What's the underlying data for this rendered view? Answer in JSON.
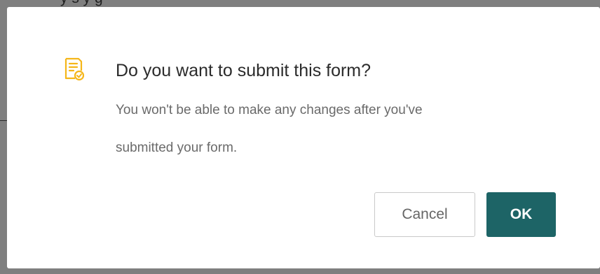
{
  "backdrop": {
    "partial_text": "y  s      y       g"
  },
  "dialog": {
    "icon": "form-check-icon",
    "title": "Do you want to submit this form?",
    "message_lines": [
      "You won't be able to make any changes after you've",
      "submitted your form."
    ],
    "buttons": {
      "cancel_label": "Cancel",
      "ok_label": "OK"
    }
  },
  "colors": {
    "icon_accent": "#f5b619",
    "primary_button": "#1d6466",
    "title_text": "#2b2b2b",
    "message_text": "#6a6a6a",
    "backdrop": "#7f7f7f"
  }
}
